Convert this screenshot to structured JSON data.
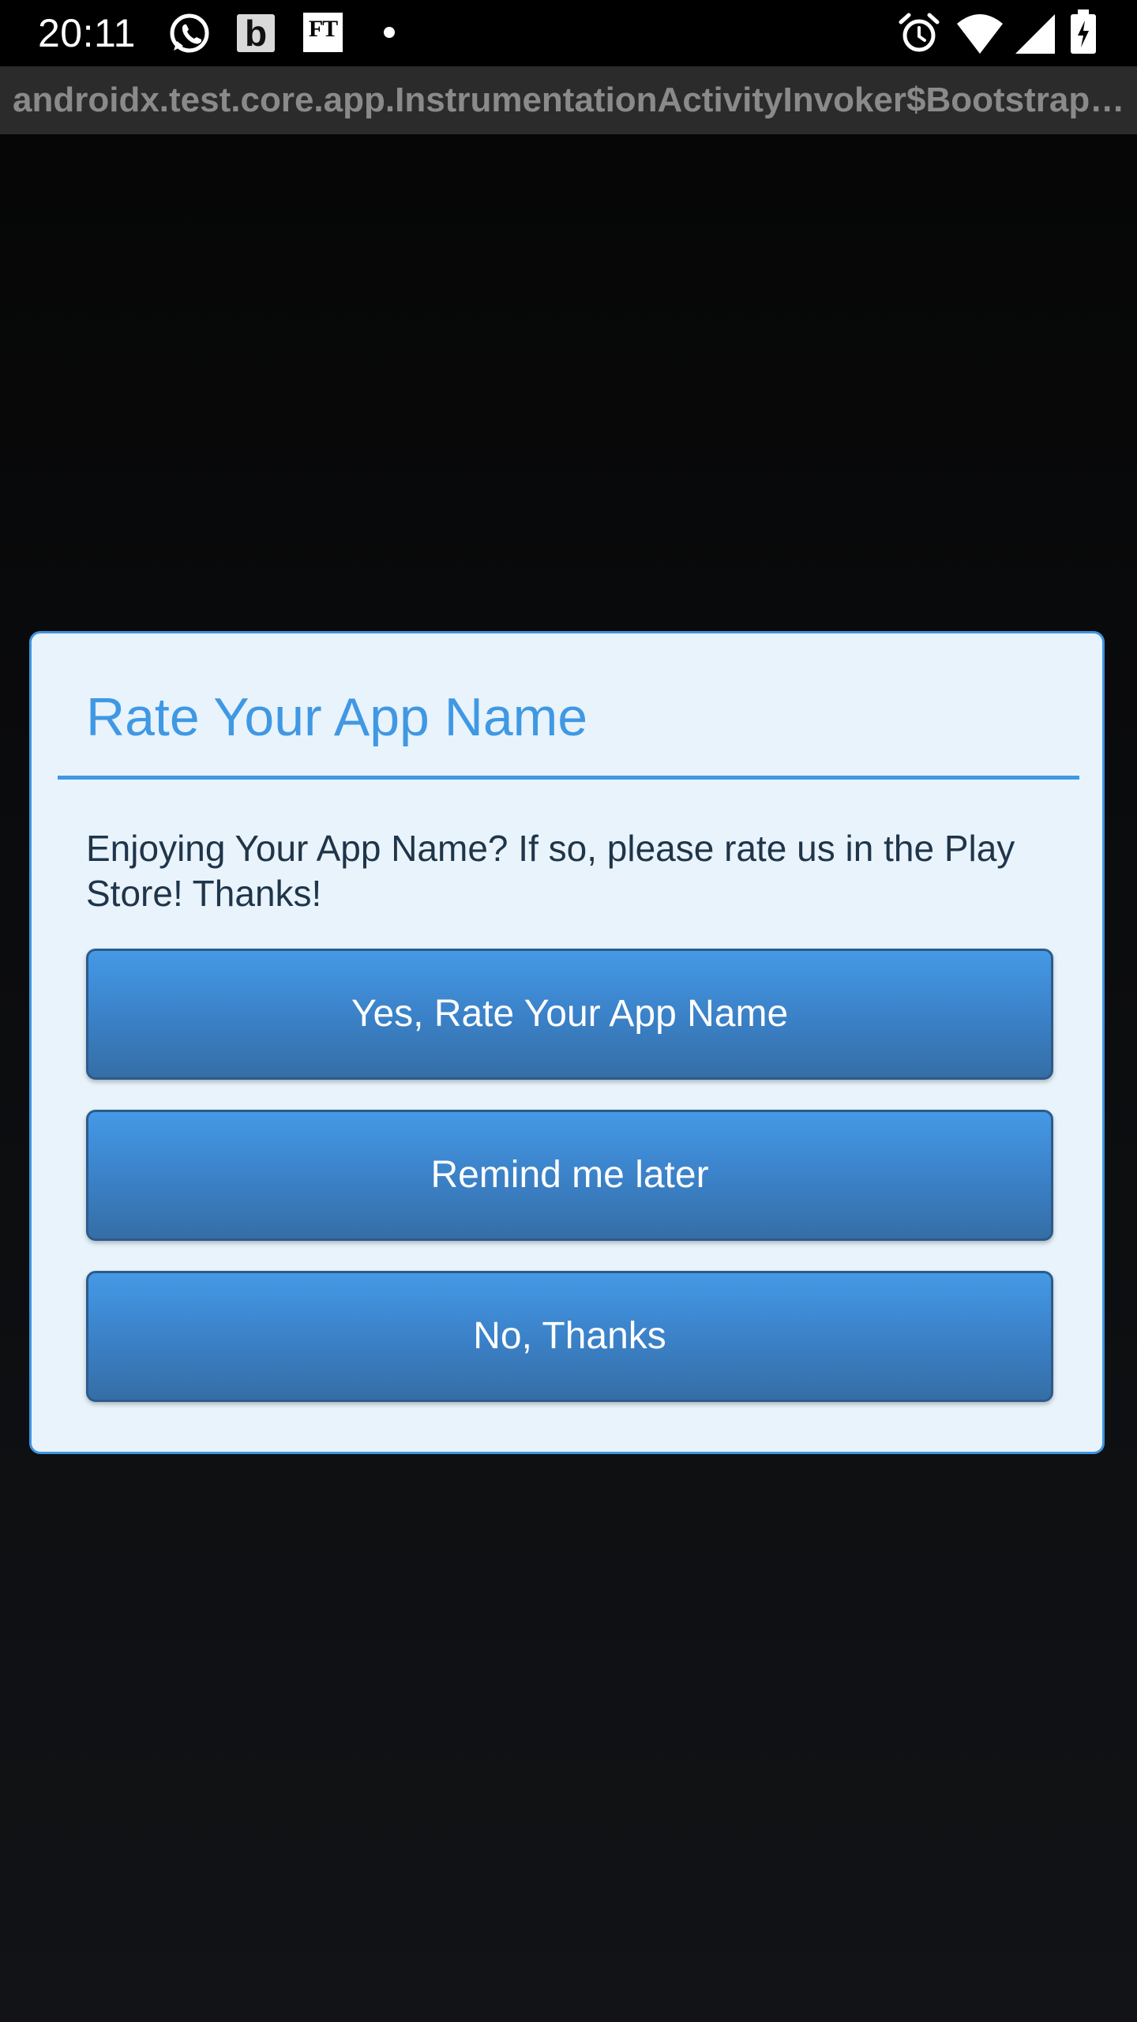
{
  "status_bar": {
    "time": "20:11",
    "icons": [
      "whatsapp-icon",
      "b-icon",
      "ft-icon",
      "dot-icon",
      "alarm-icon",
      "wifi-icon",
      "signal-icon",
      "battery-charging-icon"
    ],
    "b_icon_text": "b",
    "ft_icon_text": "FT"
  },
  "app_bar": {
    "title": "androidx.test.core.app.InstrumentationActivityInvoker$BootstrapActivity"
  },
  "dialog": {
    "title": "Rate Your App Name",
    "message": "Enjoying Your App Name? If so, please rate us in the Play Store! Thanks!",
    "buttons": {
      "rate": "Yes, Rate Your App Name",
      "later": "Remind me later",
      "no": "No, Thanks"
    }
  },
  "colors": {
    "accent": "#4098e3",
    "dialog_background": "#e8f3fc",
    "button_gradient_top": "#4599e6",
    "button_gradient_bottom": "#356ea6",
    "screen_background": "#0b0c0e"
  }
}
